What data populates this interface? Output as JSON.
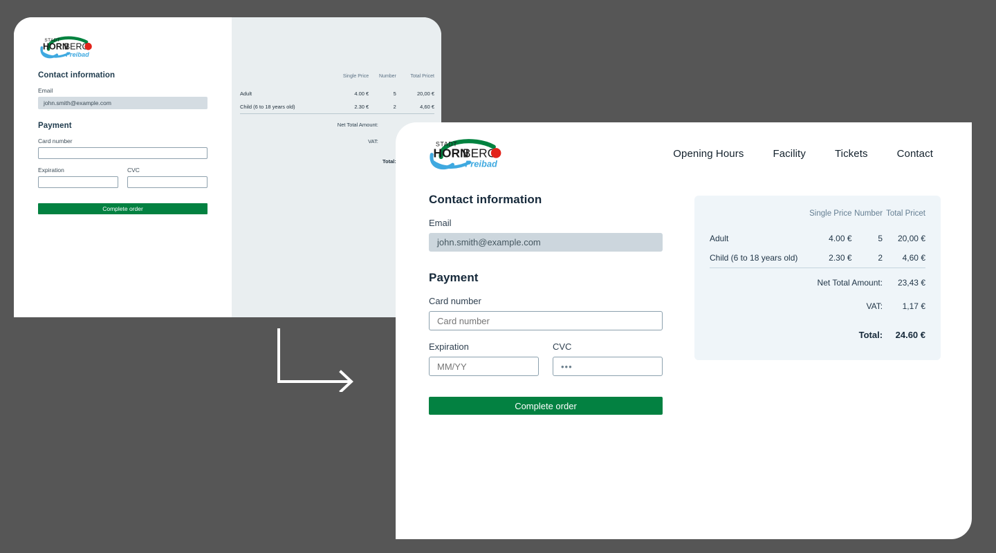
{
  "logo": {
    "top_word": "STADT",
    "main_word_bold": "HORN",
    "main_word_rest": "BERG",
    "sub_word": "Freibad",
    "dot_color": "#e2231a",
    "arc_color": "#00823f",
    "wave_color": "#3fa9e0",
    "text_color": "#1a1a1a"
  },
  "nav": {
    "items": [
      {
        "label": "Opening Hours"
      },
      {
        "label": "Facility"
      },
      {
        "label": "Tickets"
      },
      {
        "label": "Contact"
      }
    ]
  },
  "form": {
    "contact_heading": "Contact information",
    "email_label": "Email",
    "email_value": "john.smith@example.com",
    "payment_heading": "Payment",
    "card_label": "Card number",
    "card_placeholder": "Card number",
    "card_value": "",
    "expiration_label": "Expiration",
    "expiration_placeholder": "MM/YY",
    "expiration_value": "",
    "cvc_label": "CVC",
    "cvc_placeholder": "•••",
    "cvc_value": "",
    "submit_label": "Complete order"
  },
  "summary": {
    "headers": {
      "item": "",
      "single_price": "Single Price",
      "number": "Number",
      "total_price": "Total Pricet"
    },
    "rows": [
      {
        "item": "Adult",
        "single_price": "4.00 €",
        "number": "5",
        "total_price": "20,00 €"
      },
      {
        "item": "Child (6 to 18 years old)",
        "single_price": "2.30 €",
        "number": "2",
        "total_price": "4,60 €"
      }
    ],
    "totals": [
      {
        "key": "Net Total Amount:",
        "value": "23,43 €"
      },
      {
        "key": "VAT:",
        "value": "1,17 €"
      }
    ],
    "grand": {
      "key": "Total:",
      "value": "24.60 €"
    }
  },
  "theme": {
    "background": "#565656",
    "brand_green": "#038141",
    "summary_bg": "#eff5f9",
    "back_panel_bg": "#e9eef0",
    "text_dark": "#16293a"
  },
  "annotation": {
    "arrow_label": "transform-arrow",
    "arrow_color": "#ffffff"
  }
}
